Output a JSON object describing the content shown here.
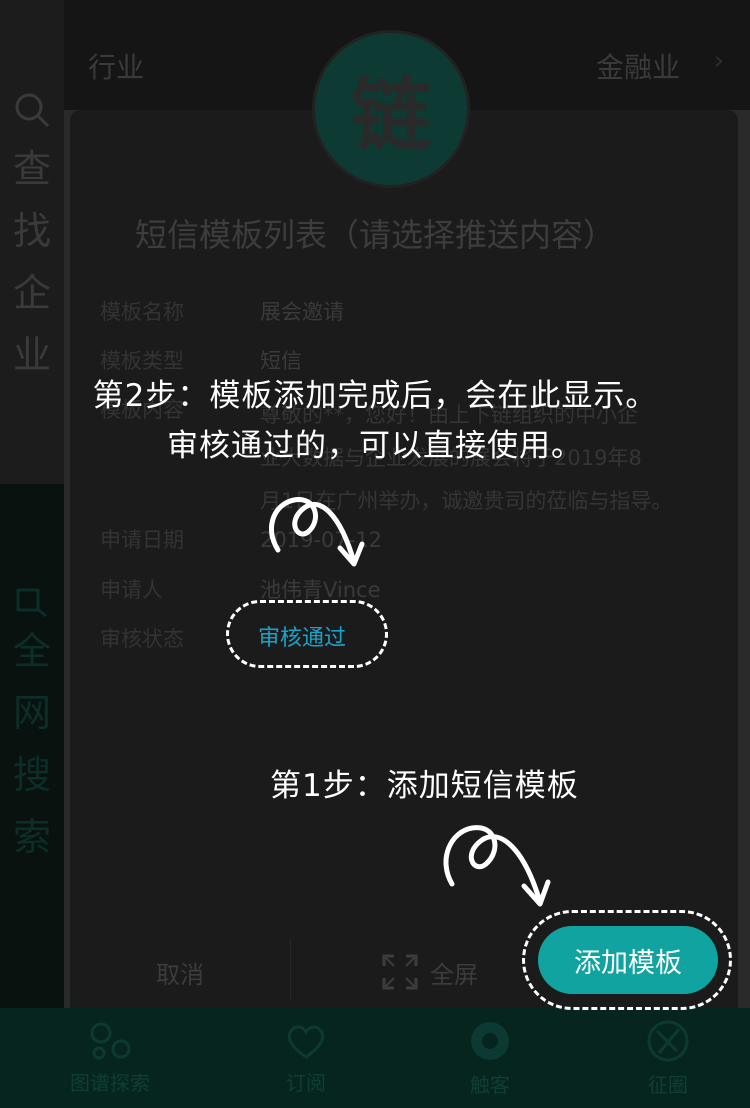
{
  "top_row": {
    "key": "行业",
    "value": "金融业",
    "chevron": "›"
  },
  "sidebar": {
    "search_label": [
      "查",
      "找",
      "企",
      "业"
    ],
    "web_label": [
      "全",
      "网",
      "搜",
      "索"
    ]
  },
  "logo": {
    "char": "链"
  },
  "dialog": {
    "title": "短信模板列表（请选择推送内容）",
    "rows": [
      {
        "label": "模板名称",
        "value": "展会邀请"
      },
      {
        "label": "模板类型",
        "value": "短信"
      },
      {
        "label": "模板内容",
        "value": ""
      },
      {
        "label": "申请日期",
        "value": "2019-07-12"
      },
      {
        "label": "申请人",
        "value": "池伟青Vince"
      },
      {
        "label": "审核状态",
        "value": "审核通过"
      }
    ],
    "content_lines": [
      "尊敬的**，您好！由上下链组织的中小企",
      "业大数据与企业发展的展会将于2019年8",
      "月1日在广州举办，诚邀贵司的莅临与指导。"
    ],
    "cancel_label": "取消",
    "fullscreen_label": "全屏",
    "add_button_label": "添加模板"
  },
  "bottom_nav": [
    {
      "label": "图谱探索",
      "icon": "graph-icon"
    },
    {
      "label": "订阅",
      "icon": "heart-plus-icon"
    },
    {
      "label": "触客",
      "icon": "circle-icon"
    },
    {
      "label": "征圈",
      "icon": "aperture-icon"
    }
  ],
  "tutorial": {
    "step2_line1": "第2步：模板添加完成后，会在此显示。",
    "step2_line2": "审核通过的，可以直接使用。",
    "step1": "第1步：添加短信模板"
  },
  "colors": {
    "accent": "#11a3a0",
    "status": "#1aa3c8",
    "overlay": "#1b1b1b"
  }
}
